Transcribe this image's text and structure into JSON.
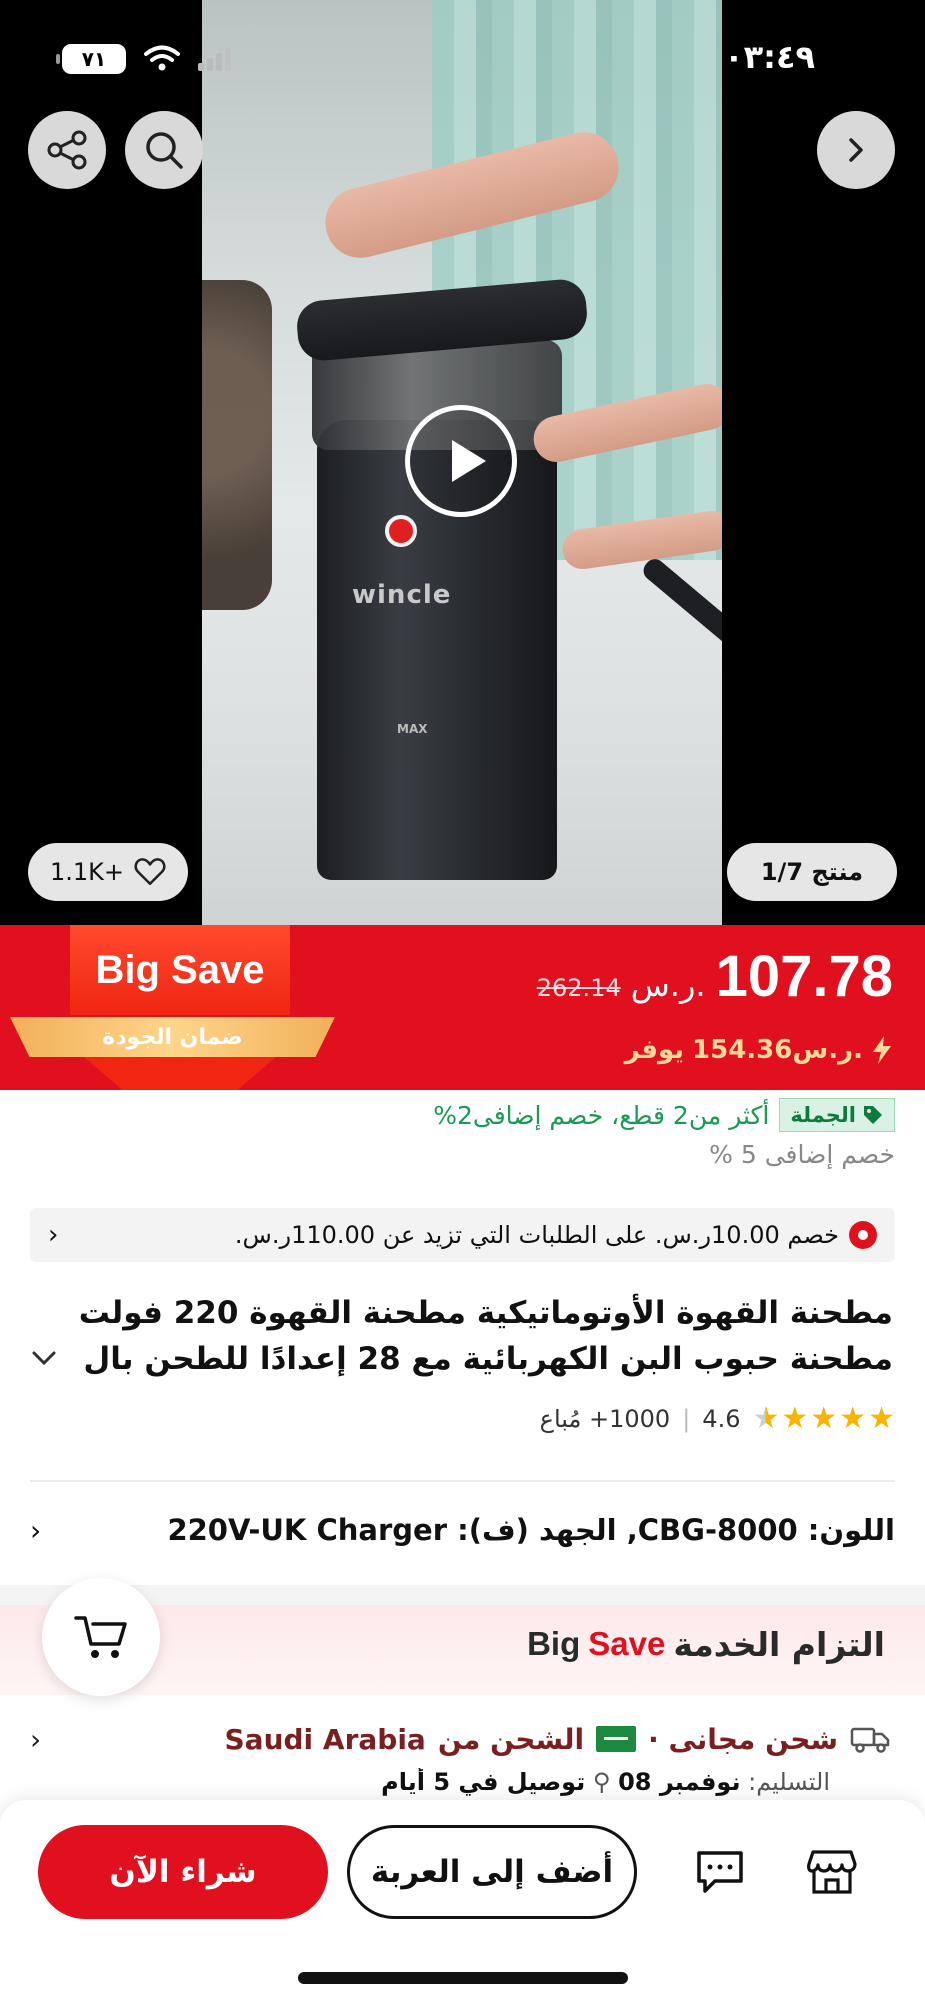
{
  "status_bar": {
    "time": "٠٣:٤٩",
    "battery": "٧١"
  },
  "media": {
    "brand_on_product": "wincle",
    "max_mark": "MAX",
    "likes": "1.1K+",
    "counter": "منتج 1/7"
  },
  "price": {
    "current": "107.78",
    "currency": "ر.س.",
    "original": "262.14",
    "savings_amount": "154.36ر.س.",
    "savings_label": "يوفر"
  },
  "promo_badge": {
    "title": "Big Save",
    "ribbon": "ضمان الجودة"
  },
  "wholesale": {
    "badge": "الجملة",
    "text": "أكثر من2 قطع، خصم إضافى2%"
  },
  "extra_discount": "خصم إضافى 5 %",
  "coupon": {
    "text": "خصم 10.00ر.س. على الطلبات التي تزيد عن 110.00ر.س."
  },
  "product": {
    "title": "مطحنة القهوة الأوتوماتيكية مطحنة القهوة 220 فولت مطحنة حبوب البن الكهربائية مع 28 إعدادًا للطحن بال"
  },
  "rating": {
    "score": "4.6",
    "sold": "1000+ مُباع"
  },
  "variant": {
    "text": "اللون: CBG-8000, الجهد (ف): 220V-UK Charger"
  },
  "service": {
    "brand_part1": "Big",
    "brand_part2": "Save",
    "title": "التزام الخدمة"
  },
  "shipping": {
    "free": "شحن مجانى ·",
    "from_label": "الشحن من",
    "country": "Saudi Arabia"
  },
  "delivery": {
    "label": "التسليم:",
    "date": "نوفمبر 08",
    "eta": "توصيل في 5 أيام"
  },
  "actions": {
    "buy_now": "شراء الآن",
    "add_to_cart": "أضف إلى العربة"
  },
  "colors": {
    "accent_red": "#e0101f",
    "wholesale_green": "#1b9a53",
    "star_gold": "#f7b500"
  }
}
